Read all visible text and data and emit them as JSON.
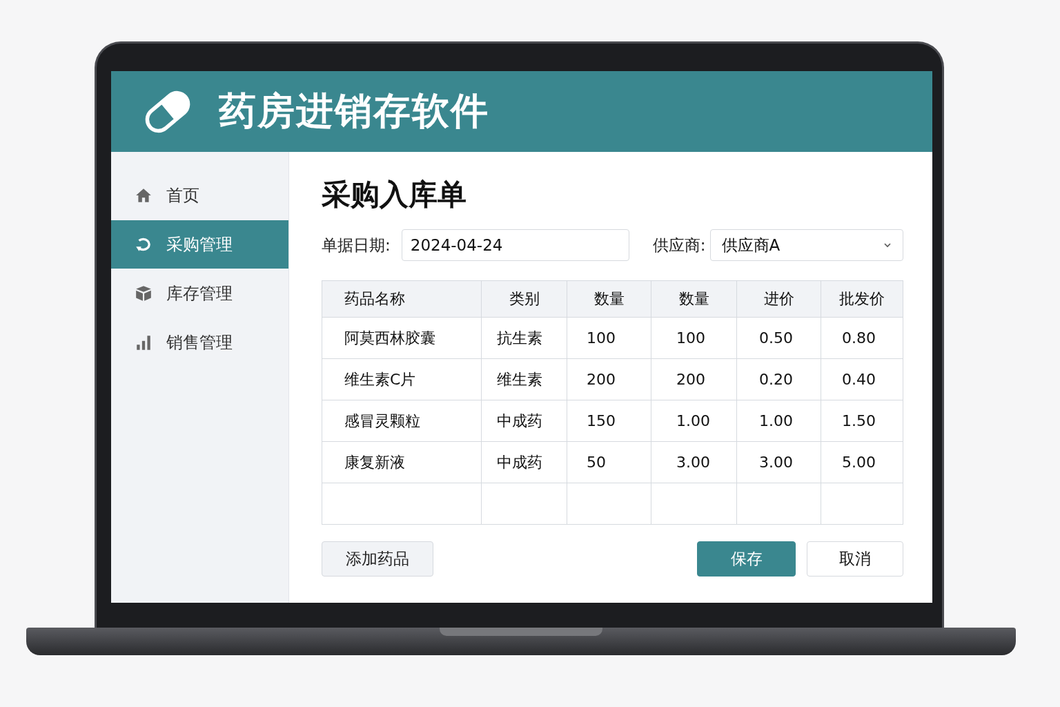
{
  "app": {
    "title": "药房进销存软件"
  },
  "sidebar": {
    "items": [
      {
        "label": "首页",
        "kind": "home",
        "selected": false
      },
      {
        "label": "采购管理",
        "kind": "refresh",
        "selected": true
      },
      {
        "label": "库存管理",
        "kind": "box",
        "selected": false
      },
      {
        "label": "销售管理",
        "kind": "chart",
        "selected": false
      }
    ]
  },
  "form": {
    "title": "采购入库单",
    "date_label": "单据日期:",
    "date_value": "2024-04-24",
    "supplier_label": "供应商:",
    "supplier_value": "供应商A"
  },
  "table": {
    "columns": [
      "药品名称",
      "类别",
      "数量",
      "数量",
      "进价",
      "批发价"
    ],
    "rows": [
      [
        "阿莫西林胶囊",
        "抗生素",
        "100",
        "100",
        "0.50",
        "0.80"
      ],
      [
        "维生素C片",
        "维生素",
        "200",
        "200",
        "0.20",
        "0.40"
      ],
      [
        "感冒灵颗粒",
        "中成药",
        "150",
        "1.00",
        "1.00",
        "1.50"
      ],
      [
        "康复新液",
        "中成药",
        "50",
        "3.00",
        "3.00",
        "5.00"
      ]
    ]
  },
  "buttons": [
    {
      "label": "添加药品",
      "kind": "secondary"
    },
    {
      "label": "保存",
      "kind": "primary"
    },
    {
      "label": "取消",
      "kind": "plain"
    }
  ]
}
